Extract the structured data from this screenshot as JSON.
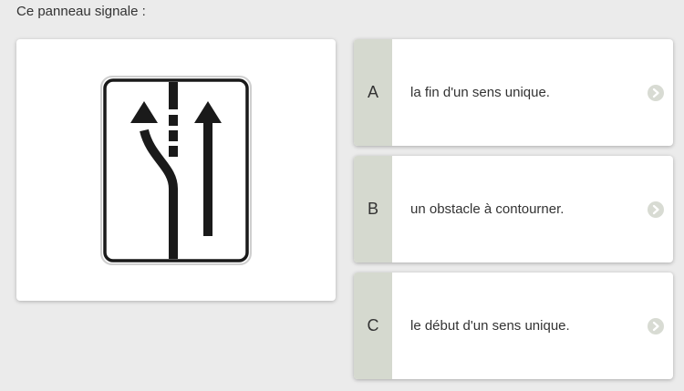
{
  "question": {
    "text": "Ce panneau signale :"
  },
  "sign": {
    "icon": "lane-split-sign-icon",
    "colors": {
      "background": "#ffffff",
      "symbol": "#1a1a1a"
    }
  },
  "answers": [
    {
      "letter": "A",
      "text": "la fin d'un sens unique."
    },
    {
      "letter": "B",
      "text": "un obstacle à contourner."
    },
    {
      "letter": "C",
      "text": "le début d'un sens unique."
    }
  ],
  "colors": {
    "page_background": "#ebebeb",
    "letter_band": "#d5d9cf",
    "chevron": "#d8dbd3"
  }
}
